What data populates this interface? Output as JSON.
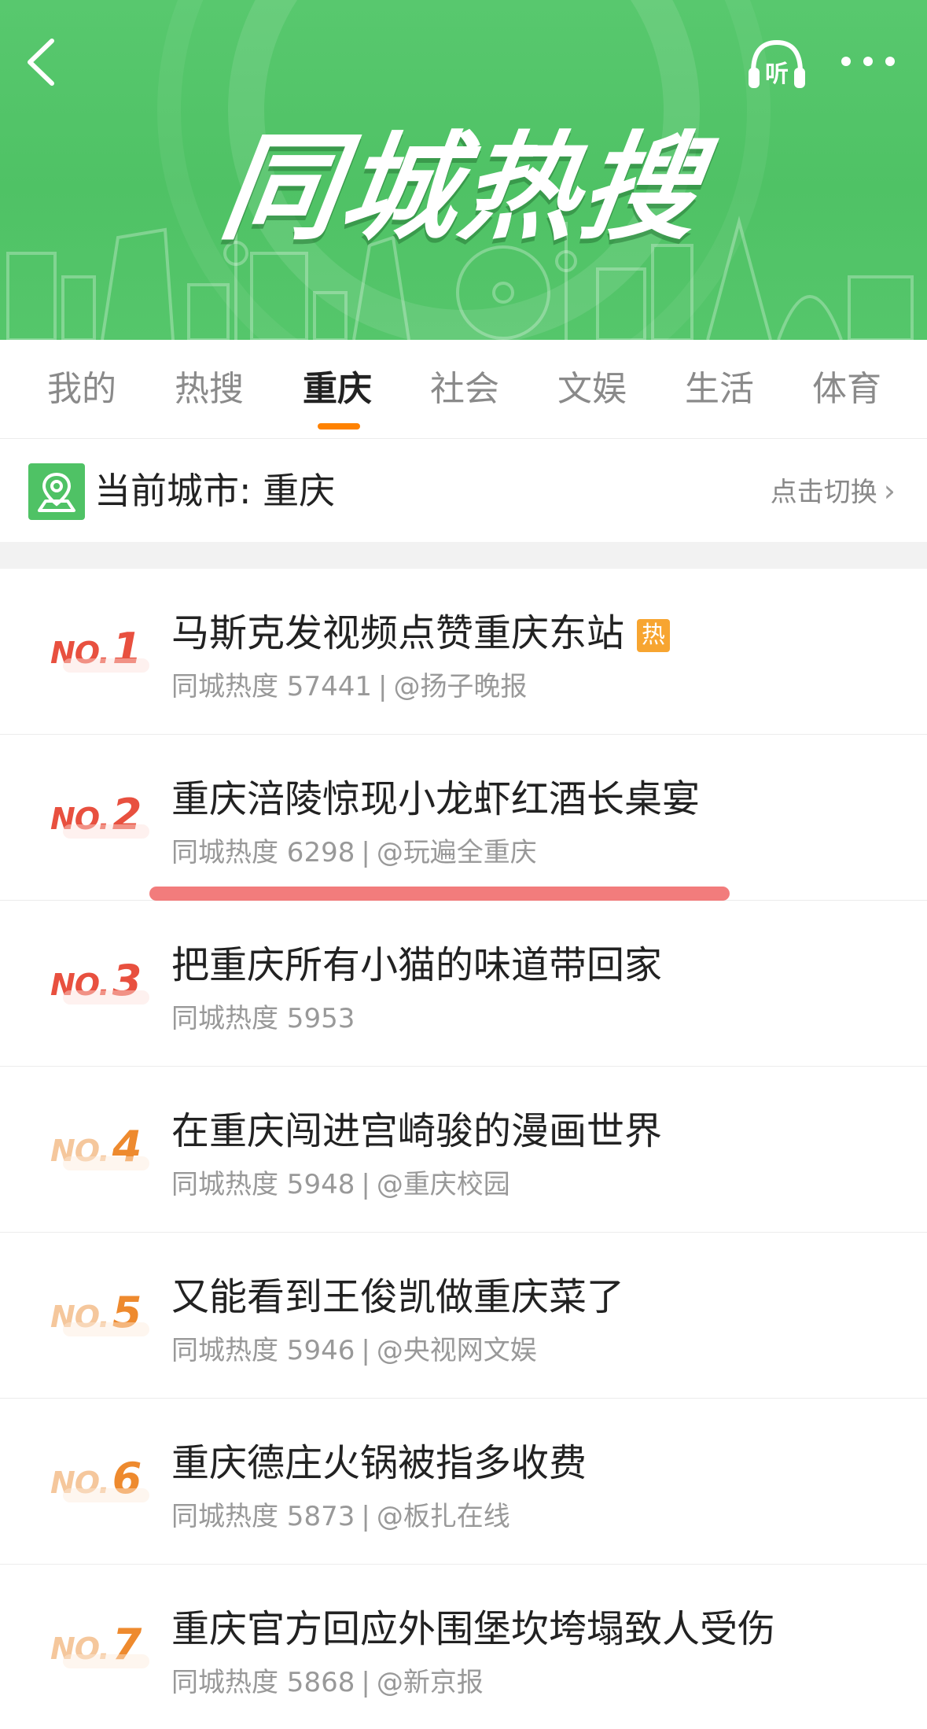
{
  "header": {
    "title": "同城热搜",
    "icons": {
      "back": "chevron-left-icon",
      "listen": "headphones-icon",
      "listen_label": "听",
      "more": "more-dots-icon"
    }
  },
  "tabs": [
    {
      "label": "我的",
      "active": false
    },
    {
      "label": "热搜",
      "active": false
    },
    {
      "label": "重庆",
      "active": true
    },
    {
      "label": "社会",
      "active": false
    },
    {
      "label": "文娱",
      "active": false
    },
    {
      "label": "生活",
      "active": false
    },
    {
      "label": "体育",
      "active": false
    }
  ],
  "city": {
    "label": "当前城市: 重庆",
    "switch_label": "点击切换",
    "chevron": "›"
  },
  "list": [
    {
      "no": "NO.",
      "rank": "1",
      "title": "马斯克发视频点赞重庆东站",
      "badge": "热",
      "heat": "同城热度 57441",
      "source": "@扬子晚报"
    },
    {
      "no": "NO.",
      "rank": "2",
      "title": "重庆涪陵惊现小龙虾红酒长桌宴",
      "badge": "",
      "heat": "同城热度 6298",
      "source": "@玩遍全重庆"
    },
    {
      "no": "NO.",
      "rank": "3",
      "title": "把重庆所有小猫的味道带回家",
      "badge": "",
      "heat": "同城热度 5953",
      "source": ""
    },
    {
      "no": "NO.",
      "rank": "4",
      "title": "在重庆闯进宫崎骏的漫画世界",
      "badge": "",
      "heat": "同城热度 5948",
      "source": "@重庆校园"
    },
    {
      "no": "NO.",
      "rank": "5",
      "title": "又能看到王俊凯做重庆菜了",
      "badge": "",
      "heat": "同城热度 5946",
      "source": "@央视网文娱"
    },
    {
      "no": "NO.",
      "rank": "6",
      "title": "重庆德庄火锅被指多收费",
      "badge": "",
      "heat": "同城热度 5873",
      "source": "@板扎在线"
    },
    {
      "no": "NO.",
      "rank": "7",
      "title": "重庆官方回应外围堡坎垮塌致人受伤",
      "badge": "",
      "heat": "同城热度 5868",
      "source": "@新京报"
    }
  ],
  "colors": {
    "brand_green": "#4fc265",
    "accent_orange": "#ff8200",
    "rank_hot": "#e8503f",
    "rank_warm": "#ee8a2e",
    "badge": "#f7a531",
    "highlight": "#f06a6a"
  }
}
